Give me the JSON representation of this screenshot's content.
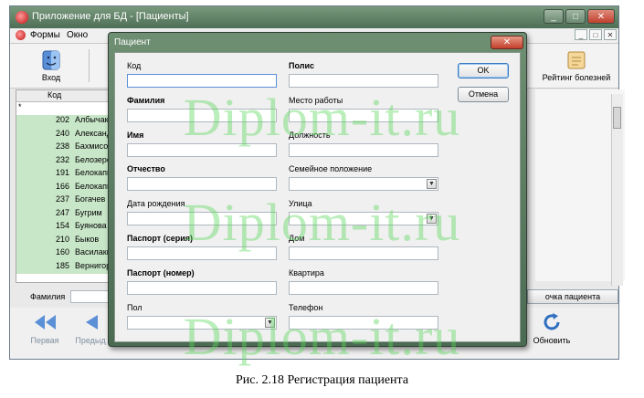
{
  "app": {
    "title": "Приложение для БД - [Пациенты]",
    "menu": [
      "Формы",
      "Окно"
    ],
    "window_controls": [
      "_",
      "□",
      "✕"
    ],
    "mdi_controls": [
      "_",
      "□",
      "✕"
    ]
  },
  "toolbar": {
    "login_label": "Вход",
    "report_label": "Рейтинг болезней"
  },
  "grid": {
    "column_code": "Код",
    "new_row_marker": "*",
    "rows": [
      {
        "code": "202",
        "name": "Албычако"
      },
      {
        "code": "240",
        "name": "Александ"
      },
      {
        "code": "238",
        "name": "Бахмисов"
      },
      {
        "code": "232",
        "name": "Белозеро"
      },
      {
        "code": "191",
        "name": "Белокапы"
      },
      {
        "code": "166",
        "name": "Белокапы"
      },
      {
        "code": "237",
        "name": "Богачев"
      },
      {
        "code": "247",
        "name": "Бугрим"
      },
      {
        "code": "154",
        "name": "Буянова"
      },
      {
        "code": "210",
        "name": "Быков"
      },
      {
        "code": "160",
        "name": "Василаки"
      },
      {
        "code": "185",
        "name": "Вернигор"
      }
    ]
  },
  "filter": {
    "lastname_label": "Фамилия",
    "card_button": "очка пациента"
  },
  "nav": {
    "first": "Первая",
    "prev": "Предыд",
    "refresh": "Обновить"
  },
  "dialog": {
    "title": "Пациент",
    "close": "✕",
    "ok": "OK",
    "cancel": "Отмена",
    "left_fields": [
      {
        "label": "Код",
        "bold": false,
        "type": "text",
        "value": ""
      },
      {
        "label": "Фамилия",
        "bold": true,
        "type": "text",
        "value": ""
      },
      {
        "label": "Имя",
        "bold": true,
        "type": "text",
        "value": ""
      },
      {
        "label": "Отчество",
        "bold": true,
        "type": "text",
        "value": ""
      },
      {
        "label": "Дата рождения",
        "bold": false,
        "type": "text",
        "value": ""
      },
      {
        "label": "Паспорт (серия)",
        "bold": true,
        "type": "text",
        "value": ""
      },
      {
        "label": "Паспорт (номер)",
        "bold": true,
        "type": "text",
        "value": ""
      },
      {
        "label": "Пол",
        "bold": false,
        "type": "select",
        "value": ""
      }
    ],
    "right_fields": [
      {
        "label": "Полис",
        "bold": true,
        "type": "text",
        "value": ""
      },
      {
        "label": "Место работы",
        "bold": false,
        "type": "text",
        "value": ""
      },
      {
        "label": "Должность",
        "bold": false,
        "type": "text",
        "value": ""
      },
      {
        "label": "Семейное положение",
        "bold": false,
        "type": "select",
        "value": ""
      },
      {
        "label": "Улица",
        "bold": false,
        "type": "select",
        "value": ""
      },
      {
        "label": "Дом",
        "bold": false,
        "type": "text",
        "value": ""
      },
      {
        "label": "Квартира",
        "bold": false,
        "type": "text",
        "value": ""
      },
      {
        "label": "Телефон",
        "bold": false,
        "type": "text",
        "value": ""
      }
    ]
  },
  "watermark": "Diplom-it.ru",
  "caption": "Рис. 2.18 Регистрация пациента",
  "colors": {
    "titlebar": "#5a7a60",
    "grid_highlight": "#c8e6c8",
    "watermark": "#5ad75a",
    "focus_border": "#5b8fd6"
  }
}
